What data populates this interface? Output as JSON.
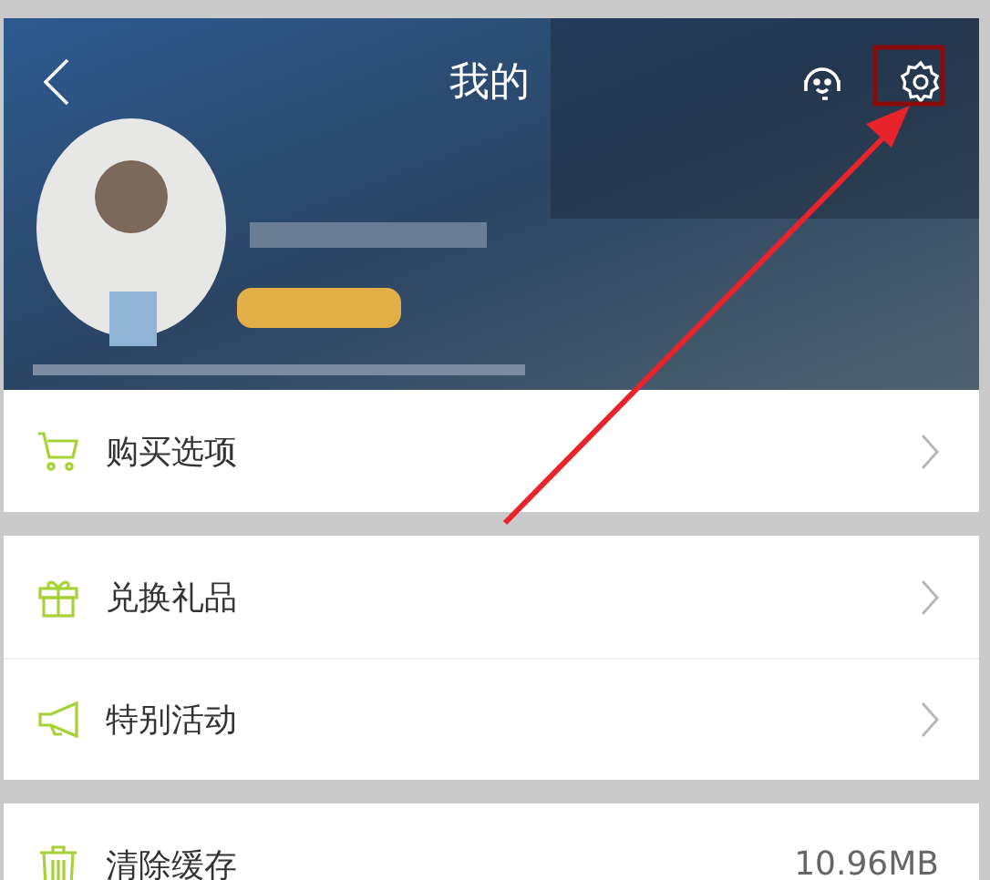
{
  "header": {
    "title": "我的"
  },
  "sections": [
    {
      "items": [
        {
          "label": "购买选项",
          "kind": "link"
        }
      ]
    },
    {
      "items": [
        {
          "label": "兑换礼品",
          "kind": "link"
        },
        {
          "label": "特别活动",
          "kind": "link"
        }
      ]
    },
    {
      "items": [
        {
          "label": "清除缓存",
          "kind": "value",
          "value": "10.96MB"
        }
      ]
    }
  ]
}
